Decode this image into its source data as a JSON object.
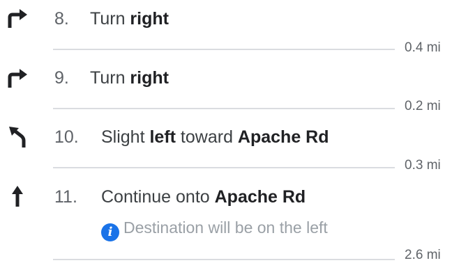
{
  "steps": [
    {
      "number": "8.",
      "icon": "turn-right-icon",
      "parts": [
        {
          "text": "Turn ",
          "bold": false
        },
        {
          "text": "right",
          "bold": true
        }
      ],
      "distance": "0.4 mi"
    },
    {
      "number": "9.",
      "icon": "turn-right-icon",
      "parts": [
        {
          "text": "Turn ",
          "bold": false
        },
        {
          "text": "right",
          "bold": true
        }
      ],
      "distance": "0.2 mi"
    },
    {
      "number": "10.",
      "icon": "slight-left-icon",
      "parts": [
        {
          "text": "Slight ",
          "bold": false
        },
        {
          "text": "left",
          "bold": true
        },
        {
          "text": " toward ",
          "bold": false
        },
        {
          "text": "Apache Rd",
          "bold": true
        }
      ],
      "distance": "0.3 mi"
    },
    {
      "number": "11.",
      "icon": "straight-icon",
      "parts": [
        {
          "text": "Continue onto ",
          "bold": false
        },
        {
          "text": "Apache Rd",
          "bold": true
        }
      ],
      "note": "Destination will be on the left",
      "note_icon": "info-icon",
      "distance": "2.6 mi"
    }
  ],
  "colors": {
    "text": "#3c4043",
    "bold_text": "#202124",
    "muted": "#5f6368",
    "divider": "#dadce0",
    "note": "#9aa0a6",
    "info_blue": "#1a73e8",
    "icon": "#202124"
  }
}
